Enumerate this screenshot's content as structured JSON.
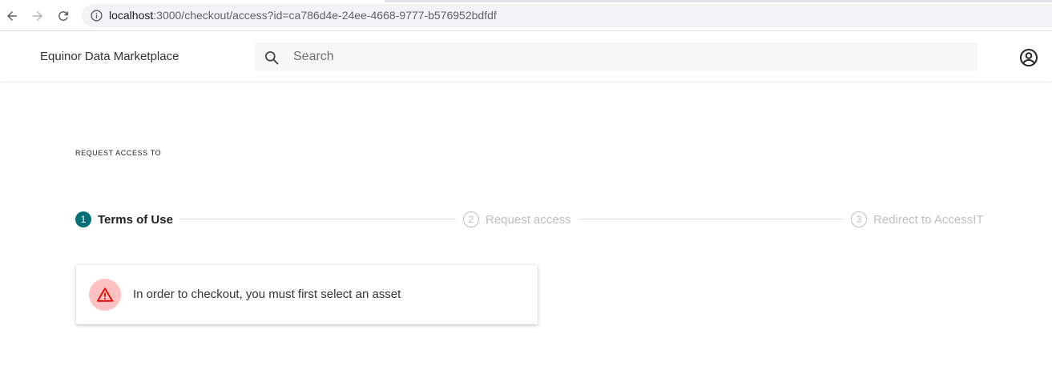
{
  "browser": {
    "url_host": "localhost",
    "url_path": ":3000/checkout/access?id=ca786d4e-24ee-4668-9777-b576952bdfdf"
  },
  "header": {
    "brand": "Equinor Data Marketplace",
    "search": {
      "placeholder": "Search",
      "value": ""
    },
    "icons": {
      "search": "search-icon",
      "account": "account-circle-icon"
    }
  },
  "main": {
    "section_label": "REQUEST ACCESS TO",
    "steps": [
      {
        "number": "1",
        "label": "Terms of Use",
        "active": true
      },
      {
        "number": "2",
        "label": "Request access",
        "active": false
      },
      {
        "number": "3",
        "label": "Redirect to AccessIT",
        "active": false
      }
    ],
    "alert": {
      "message": "In order to checkout, you must first select an asset",
      "icon": "warning-icon"
    }
  },
  "colors": {
    "primary": "#007079",
    "danger": "#eb0000",
    "danger_bg": "#ffc1c1",
    "inactive": "#bebebe"
  }
}
